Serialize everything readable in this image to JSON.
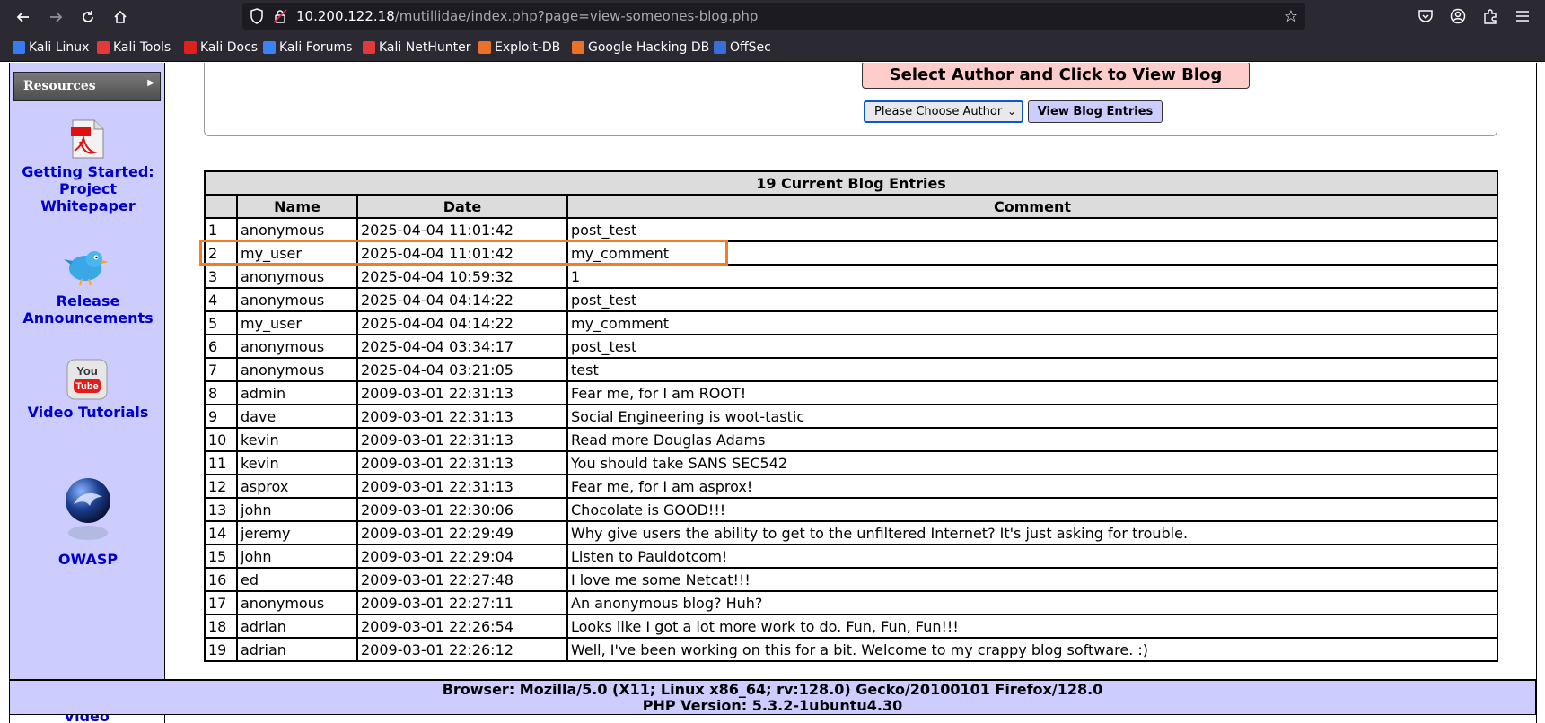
{
  "browser": {
    "url_host": "10.200.122.18",
    "url_path": "/mutillidae/index.php?page=view-someones-blog.php",
    "bookmarks": [
      {
        "label": "Kali Linux",
        "color": "#367bf0"
      },
      {
        "label": "Kali Tools",
        "color": "#e23a3a"
      },
      {
        "label": "Kali Docs",
        "color": "#e01f1f"
      },
      {
        "label": "Kali Forums",
        "color": "#3b82f6"
      },
      {
        "label": "Kali NetHunter",
        "color": "#e23a3a"
      },
      {
        "label": "Exploit-DB",
        "color": "#e7732a"
      },
      {
        "label": "Google Hacking DB",
        "color": "#e7732a"
      },
      {
        "label": "OffSec",
        "color": "#3b6dd9"
      }
    ]
  },
  "sidebar": {
    "resources_label": "Resources",
    "links": [
      {
        "label": "Getting Started: Project Whitepaper",
        "icon": "pdf-icon"
      },
      {
        "label": "Release Announcements",
        "icon": "twitter-bird-icon"
      },
      {
        "label": "Video Tutorials",
        "icon": "youtube-icon"
      },
      {
        "label": "OWASP",
        "icon": "owasp-icon"
      }
    ],
    "cut_off_label": "Video"
  },
  "blog_form": {
    "title": "Select Author and Click to View Blog",
    "author_select_value": "Please Choose Author",
    "view_button_label": "View Blog Entries"
  },
  "blog_table": {
    "caption": "19 Current Blog Entries",
    "columns": [
      "",
      "Name",
      "Date",
      "Comment"
    ],
    "rows": [
      [
        "1",
        "anonymous",
        "2025-04-04 11:01:42",
        "post_test"
      ],
      [
        "2",
        "my_user",
        "2025-04-04 11:01:42",
        "my_comment"
      ],
      [
        "3",
        "anonymous",
        "2025-04-04 10:59:32",
        "1"
      ],
      [
        "4",
        "anonymous",
        "2025-04-04 04:14:22",
        "post_test"
      ],
      [
        "5",
        "my_user",
        "2025-04-04 04:14:22",
        "my_comment"
      ],
      [
        "6",
        "anonymous",
        "2025-04-04 03:34:17",
        "post_test"
      ],
      [
        "7",
        "anonymous",
        "2025-04-04 03:21:05",
        "test"
      ],
      [
        "8",
        "admin",
        "2009-03-01 22:31:13",
        "Fear me, for I am ROOT!"
      ],
      [
        "9",
        "dave",
        "2009-03-01 22:31:13",
        "Social Engineering is woot-tastic"
      ],
      [
        "10",
        "kevin",
        "2009-03-01 22:31:13",
        "Read more Douglas Adams"
      ],
      [
        "11",
        "kevin",
        "2009-03-01 22:31:13",
        "You should take SANS SEC542"
      ],
      [
        "12",
        "asprox",
        "2009-03-01 22:31:13",
        "Fear me, for I am asprox!"
      ],
      [
        "13",
        "john",
        "2009-03-01 22:30:06",
        "Chocolate is GOOD!!!"
      ],
      [
        "14",
        "jeremy",
        "2009-03-01 22:29:49",
        "Why give users the ability to get to the unfiltered Internet? It's just asking for trouble."
      ],
      [
        "15",
        "john",
        "2009-03-01 22:29:04",
        "Listen to Pauldotcom!"
      ],
      [
        "16",
        "ed",
        "2009-03-01 22:27:48",
        "I love me some Netcat!!!"
      ],
      [
        "17",
        "anonymous",
        "2009-03-01 22:27:11",
        "An anonymous blog? Huh?"
      ],
      [
        "18",
        "adrian",
        "2009-03-01 22:26:54",
        "Looks like I got a lot more work to do. Fun, Fun, Fun!!!"
      ],
      [
        "19",
        "adrian",
        "2009-03-01 22:26:12",
        "Well, I've been working on this for a bit. Welcome to my crappy blog software. :)"
      ]
    ]
  },
  "highlight_color": "#f57c1f",
  "footer": {
    "browser_line": "Browser: Mozilla/5.0 (X11; Linux x86_64; rv:128.0) Gecko/20100101 Firefox/128.0",
    "php_line": "PHP Version: 5.3.2-1ubuntu4.30"
  }
}
